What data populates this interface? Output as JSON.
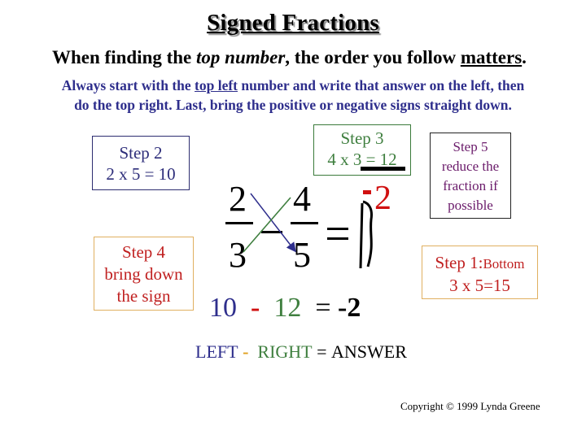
{
  "title": "Signed Fractions",
  "subtitle": {
    "part1": "When finding the ",
    "emphasis": "top number",
    "part2": ", the order you follow ",
    "underlined": "matters",
    "part3": "."
  },
  "instructions": {
    "part1": "Always start with the ",
    "underlined": "top left",
    "part2": " number and write that answer on the left, then",
    "line2": "do the top right.  Last, bring the positive or negative signs straight down."
  },
  "steps": {
    "step1": {
      "heading": "Step 1:",
      "heading_small": "Bottom",
      "body": "3 x 5=15"
    },
    "step2": {
      "heading": "Step 2",
      "body": "2 x 5 = 10"
    },
    "step3": {
      "heading": "Step 3",
      "body": "4 x 3 = 12"
    },
    "step4": {
      "line1": "Step 4",
      "line2": "bring down",
      "line3": "the sign"
    },
    "step5": {
      "line1": "Step 5",
      "line2": "reduce the",
      "line3": "fraction if",
      "line4": "possible"
    }
  },
  "fraction_problem": {
    "left_numerator": "2",
    "left_denominator": "3",
    "operator": "–",
    "right_numerator": "4",
    "right_denominator": "5",
    "equals": "=",
    "result_sign": "-",
    "result_numerator": "2"
  },
  "bottom_equation": {
    "left": "10",
    "minus": "-",
    "right": "12",
    "equals": "=",
    "answer": "-2"
  },
  "formula": {
    "left": "LEFT",
    "minus": "-",
    "right": "RIGHT",
    "equals": "=",
    "answer": "ANSWER"
  },
  "copyright": "Copyright © 1999 Lynda Greene",
  "colors": {
    "left_blue": "#2e2e8c",
    "right_green": "#3f7f3f",
    "sign_red": "#d01010",
    "step5_purple": "#6a1a6a",
    "orange_border": "#e0b060"
  }
}
